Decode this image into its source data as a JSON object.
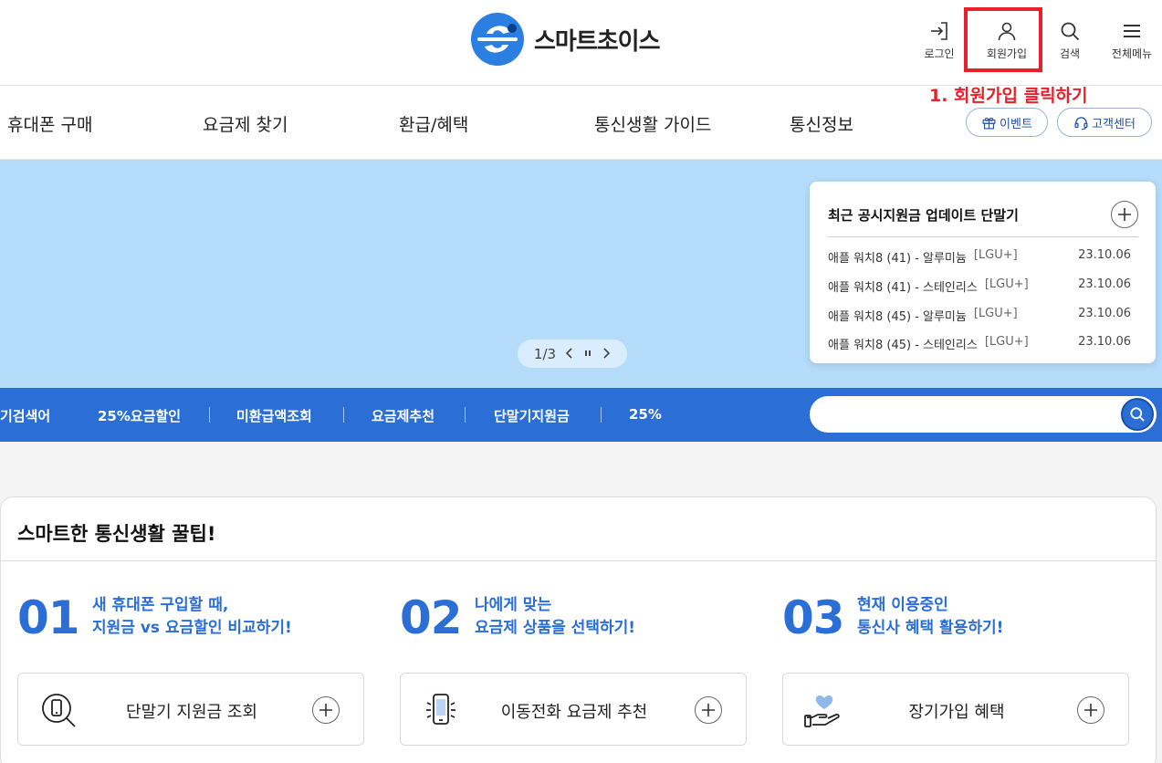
{
  "header": {
    "brand": "스마트초이스",
    "utility": [
      {
        "label": "로그인",
        "icon": "login-icon"
      },
      {
        "label": "회원가입",
        "icon": "user-icon"
      },
      {
        "label": "검색",
        "icon": "search-icon"
      },
      {
        "label": "전체메뉴",
        "icon": "menu-icon"
      }
    ],
    "annotation": "1. 회원가입 클릭하기"
  },
  "nav": {
    "items": [
      "휴대폰 구매",
      "요금제 찾기",
      "환급/혜택",
      "통신생활 가이드",
      "통신정보"
    ],
    "event_label": "이벤트",
    "support_label": "고객센터"
  },
  "hero": {
    "slider_counter": "1/3",
    "update_title": "최근 공시지원금 업데이트 단말기",
    "updates": [
      {
        "name": "애플 워치8 (41) - 알루미늄",
        "carrier": "[LGU+]",
        "date": "23.10.06"
      },
      {
        "name": "애플 워치8 (41) - 스테인리스",
        "carrier": "[LGU+]",
        "date": "23.10.06"
      },
      {
        "name": "애플 워치8 (45) - 알루미늄",
        "carrier": "[LGU+]",
        "date": "23.10.06"
      },
      {
        "name": "애플 워치8 (45) - 스테인리스",
        "carrier": "[LGU+]",
        "date": "23.10.06"
      }
    ]
  },
  "keywords": {
    "title": "기검색어",
    "items": [
      "25%요금할인",
      "미환급액조회",
      "요금제추천",
      "단말기지원금",
      "25%"
    ],
    "search_placeholder": ""
  },
  "tips": {
    "title": "스마트한 통신생활 꿀팁!",
    "items": [
      {
        "num": "01",
        "line1": "새 휴대폰 구입할 때,",
        "line2": "지원금 vs 요금할인 비교하기!",
        "box_label": "단말기 지원금 조회",
        "icon": "phone-search-icon"
      },
      {
        "num": "02",
        "line1": "나에게 맞는",
        "line2": "요금제 상품을 선택하기!",
        "box_label": "이동전화 요금제 추천",
        "icon": "phone-ring-icon"
      },
      {
        "num": "03",
        "line1": "현재 이용중인",
        "line2": "통신사 혜택 활용하기!",
        "box_label": "장기가입 혜택",
        "icon": "heart-hand-icon"
      }
    ]
  },
  "colors": {
    "primary": "#2a6ed6",
    "hero_bg": "#b5dcfb",
    "annotation": "#e8202a"
  }
}
